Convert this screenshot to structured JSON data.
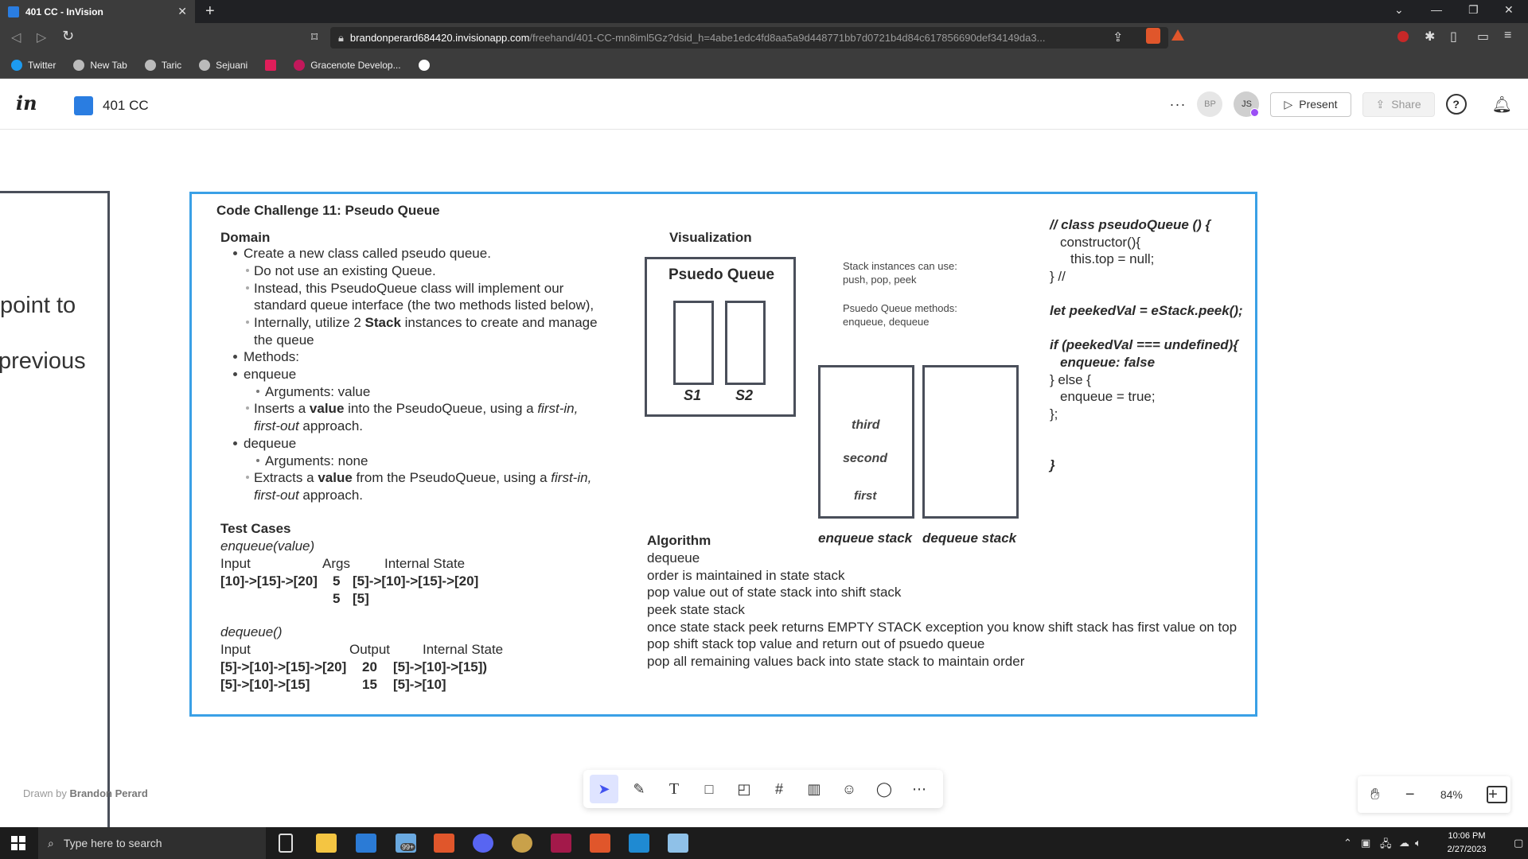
{
  "browser": {
    "tab_title": "401 CC - InVision",
    "tab_close": "✕",
    "new_tab": "+",
    "url_domain": "brandonperard684420.invisionapp.com",
    "url_path": "/freehand/401-CC-mn8iml5Gz?dsid_h=4abe1edc4fd8aa5a9d448771bb7d0721b4d84c617856690def34149da3...",
    "bookmarks": [
      "Twitter",
      "New Tab",
      "Taric",
      "Sejuani",
      "",
      "Gracenote Develop...",
      ""
    ]
  },
  "header": {
    "logo": "in",
    "doc_title": "401 CC",
    "more": "···",
    "avatars": [
      "BP",
      "JS"
    ],
    "present_label": "Present",
    "share_label": "Share",
    "help": "?"
  },
  "canvas": {
    "left_partial": [
      "point to",
      "previous"
    ],
    "board": {
      "title": "Code Challenge 11: Pseudo Queue",
      "domain_heading": "Domain",
      "domain": {
        "create": "Create a new class called pseudo queue.",
        "no_existing": "Do not use an existing Queue.",
        "instead_1": "Instead, this PseudoQueue class will implement our",
        "instead_2": "standard queue interface (the two methods listed below),",
        "internally_1a": "Internally, utilize 2 ",
        "internally_1b": "Stack",
        "internally_1c": " instances to create and manage",
        "internally_2": "the queue",
        "methods": "Methods:",
        "enqueue": "enqueue",
        "enq_args": "Arguments: value",
        "enq_desc_a": "Inserts a ",
        "enq_desc_b": "value",
        "enq_desc_c": " into the PseudoQueue, using a ",
        "enq_desc_d": "first-in,",
        "enq_desc2_a": "first-out",
        "enq_desc2_b": " approach.",
        "dequeue": "dequeue",
        "deq_args": "Arguments: none",
        "deq_desc_a": "Extracts a ",
        "deq_desc_b": "value",
        "deq_desc_c": " from the PseudoQueue, using a ",
        "deq_desc_d": "first-in,",
        "deq_desc2_a": "first-out",
        "deq_desc2_b": " approach."
      },
      "tests": {
        "heading": "Test Cases",
        "enqueue_sig": "enqueue(value)",
        "enq_headers": [
          "Input",
          "Args",
          "Internal State"
        ],
        "enq_row1": [
          "[10]->[15]->[20]",
          "5",
          "[5]->[10]->[15]->[20]"
        ],
        "enq_row2": [
          "",
          "5",
          "[5]"
        ],
        "dequeue_sig": "dequeue()",
        "deq_headers": [
          "Input",
          "Output",
          "Internal State"
        ],
        "deq_row1": [
          "[5]->[10]->[15]->[20]",
          "20",
          "[5]->[10]->[15])"
        ],
        "deq_row2": [
          "[5]->[10]->[15]",
          "15",
          "[5]->[10]"
        ]
      },
      "visualization": {
        "heading": "Visualization",
        "box_title": "Psuedo Queue",
        "s1": "S1",
        "s2": "S2",
        "note1_l1": "Stack instances can use:",
        "note1_l2": "push, pop, peek",
        "note2_l1": "Psuedo Queue methods:",
        "note2_l2": "enqueue, dequeue",
        "stack_items": [
          "third",
          "second",
          "first"
        ],
        "enqueue_label": "enqueue stack",
        "dequeue_label": "dequeue stack"
      },
      "code": {
        "l1": "// class pseudoQueue () {",
        "l2": "constructor(){",
        "l3": "this.top = null;",
        "l4": "} //",
        "l5": "let peekedVal = eStack.peek();",
        "l6": "if (peekedVal === undefined){",
        "l7": "enqueue: false",
        "l8": "} else {",
        "l9": "enqueue = true;",
        "l10": "};",
        "l11": "}"
      },
      "algorithm": {
        "heading": "Algorithm",
        "lines": [
          "dequeue",
          "order is maintained in state stack",
          "pop value out of state stack into shift stack",
          "peek state stack",
          "once state stack peek returns EMPTY STACK exception you know shift stack has first value on top",
          "pop shift stack top value and return out of psuedo queue",
          "pop all remaining values back into state stack to maintain order"
        ]
      }
    },
    "drawn_by_prefix": "Drawn by ",
    "drawn_by_name": "Brandon Perard"
  },
  "toolbar": {
    "tools": [
      "select-tool",
      "pen-tool",
      "text-tool",
      "shape-tool",
      "sticky-note-tool",
      "frame-tool",
      "chart-tool",
      "sticker-tool",
      "comment-tool",
      "more-tool"
    ],
    "zoom": "84%",
    "zoom_minus": "−",
    "zoom_plus": "+"
  },
  "taskbar": {
    "search_placeholder": "Type here to search",
    "badge": "99+",
    "time": "10:06 PM",
    "date": "2/27/2023"
  },
  "colors": {
    "board_border": "#3aa0e6",
    "accent": "#2a7de1",
    "active_tool": "#4253f0"
  }
}
